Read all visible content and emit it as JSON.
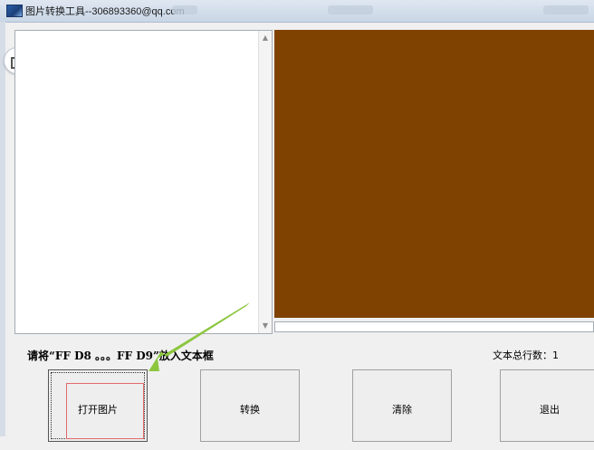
{
  "window": {
    "title": "图片转换工具--306893360@qq.com",
    "app_icon": "picture-app-icon"
  },
  "side_gadget": {
    "icon": "add-window-icon",
    "accent": "#ff6a00"
  },
  "textbox": {
    "value": ""
  },
  "preview": {
    "fill_color": "#7f4200"
  },
  "instruction": "请将“FF D8 。。。FF D9”放入文本框",
  "line_count": {
    "label": "文本总行数：",
    "value": "1"
  },
  "buttons": {
    "open_image": "打开图片",
    "convert": "转换",
    "clear": "清除",
    "exit": "退出"
  },
  "annotation": {
    "arrow_color": "#8cc63f"
  }
}
